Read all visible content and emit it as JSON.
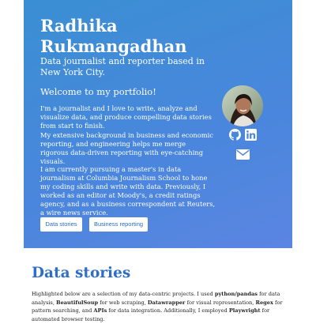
{
  "hero": {
    "name": "Radhika Rukmangadhan",
    "tagline": "Data journalist and reporter based in New York City.",
    "welcome": "Welcome to my portfolio!",
    "bio_1": "I'm a journalist and I love to write, analyze and visualize data, and produce compelling data stories from start to finish.",
    "bio_2": "My extensive background in business and economic reporting, and engineering helps me merge rigorous data-driven reporting with eye-catching visuals.",
    "bio_3": "I am currently pursuing a master's in data journalism at Columbia Journalism School to hone my coding skills and write with data. Previously, I worked as an editor at Moody's, a credit ratings agency, and as a business correspondent at Reuters, a wire news service.",
    "buttons": {
      "data_stories": "Data stories",
      "business_reporting": "Business reporting"
    },
    "icons": [
      "github-icon",
      "linkedin-icon",
      "email-icon"
    ]
  },
  "section": {
    "title": "Data stories",
    "intro": {
      "t1": "Highlighted below are a selection of my data-centric projects. I used ",
      "b1": "python/pandas",
      "t2": " for data analysis, ",
      "b2": "BeautifulSoup",
      "t3": " for web scraping, ",
      "b3": "Datawrapper",
      "t4": " for visual representation, ",
      "b4": "Regex",
      "t5": " for pattern searching, and ",
      "b5": "APIs",
      "t6": " for data integration. Additionally, I employed ",
      "b6": "Playwright",
      "t7": " for automated browser testing."
    }
  },
  "colors": {
    "hero_gradient_start": "#3a8fd3",
    "hero_gradient_end": "#5b85e2",
    "section_title": "#2e6ec9",
    "button_text": "#2a6cc0"
  }
}
